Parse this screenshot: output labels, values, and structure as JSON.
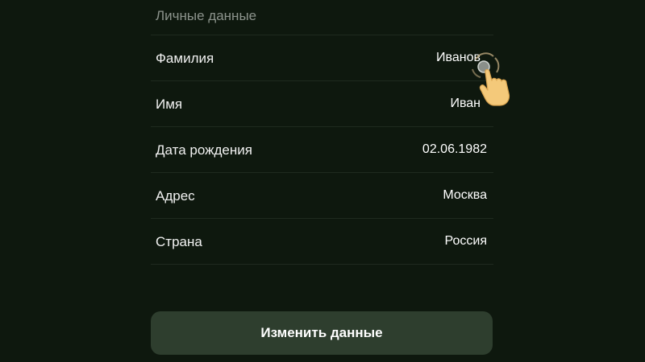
{
  "section": {
    "title": "Личные данные"
  },
  "fields": [
    {
      "label": "Фамилия",
      "value": "Иванов"
    },
    {
      "label": "Имя",
      "value": "Иван"
    },
    {
      "label": "Дата рождения",
      "value": "02.06.1982"
    },
    {
      "label": "Адрес",
      "value": "Москва"
    },
    {
      "label": "Страна",
      "value": "Россия"
    }
  ],
  "actions": {
    "edit_label": "Изменить данные"
  },
  "colors": {
    "background": "#0e180e",
    "button": "#2e3e2e",
    "hint_hand": "#f4c97a"
  },
  "icons": {
    "tap_hint": "tap-hand-icon"
  }
}
